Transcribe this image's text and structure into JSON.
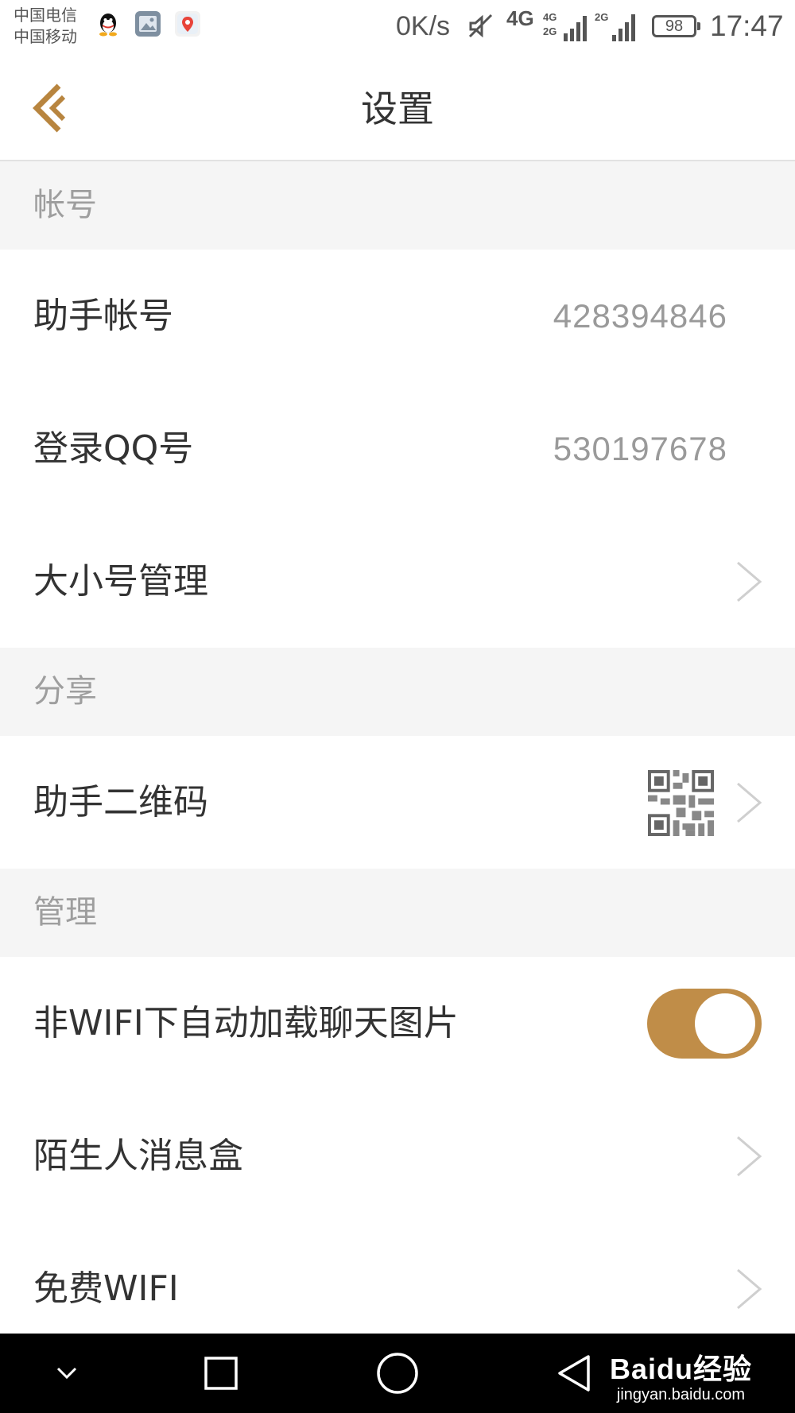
{
  "status_bar": {
    "carrier_1": "中国电信",
    "carrier_2": "中国移动",
    "net_speed": "0K/s",
    "network_type": "4G",
    "signal_label_1a": "4G",
    "signal_label_1b": "2G",
    "signal_label_2": "2G",
    "battery": "98",
    "time": "17:47",
    "icons": [
      "qq-icon",
      "gallery-icon",
      "maps-icon",
      "mute-icon",
      "signal-icon",
      "battery-icon"
    ]
  },
  "header": {
    "title": "设置"
  },
  "sections": [
    {
      "label": "帐号",
      "rows": [
        {
          "label": "助手帐号",
          "value": "428394846"
        },
        {
          "label": "登录QQ号",
          "value": "530197678"
        },
        {
          "label": "大小号管理"
        }
      ]
    },
    {
      "label": "分享",
      "rows": [
        {
          "label": "助手二维码"
        }
      ]
    },
    {
      "label": "管理",
      "rows": [
        {
          "label": "非WIFI下自动加载聊天图片",
          "toggle_on": true
        },
        {
          "label": "陌生人消息盒"
        },
        {
          "label": "免费WIFI"
        }
      ]
    }
  ],
  "navbar": {
    "watermark_brand": "Baidu经验",
    "watermark_url": "jingyan.baidu.com"
  },
  "colors": {
    "accent": "#c08d48",
    "section_bg": "#f5f5f5",
    "text_primary": "#333333",
    "text_secondary": "#9a9a9a"
  }
}
